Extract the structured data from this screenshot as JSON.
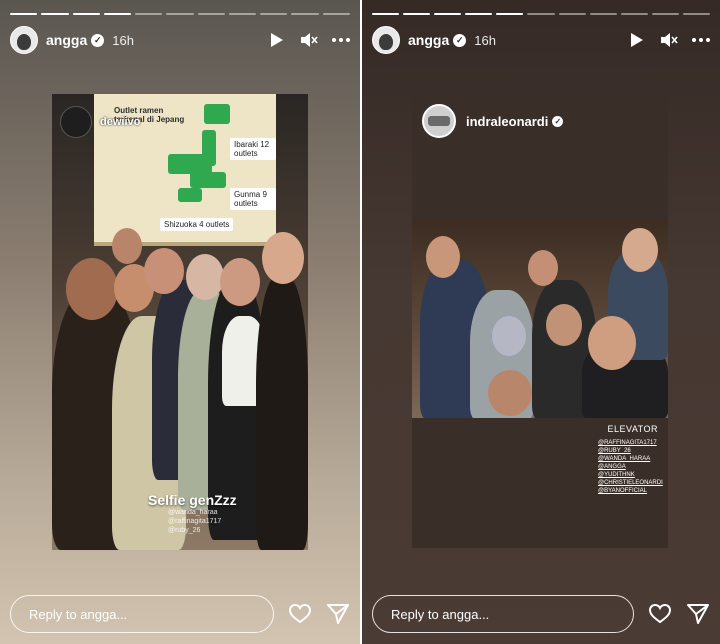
{
  "stories": [
    {
      "username": "angga",
      "time": "16h",
      "reply_placeholder": "Reply to angga...",
      "poster": {
        "username": "dewiivo"
      },
      "board": {
        "title": "Outlet ramen terkenal di Jepang",
        "tags": [
          "Ibaraki 12 outlets",
          "Gunma 9 outlets",
          "Shizuoka 4 outlets"
        ]
      },
      "caption": "Selfie genZzz",
      "mentions": [
        "@wanda_haraa",
        "@raffinagita1717",
        "@ruby_26"
      ],
      "progress_segments": 11,
      "progress_done": 4
    },
    {
      "username": "angga",
      "time": "16h",
      "reply_placeholder": "Reply to angga...",
      "repost": {
        "username": "indraleonardi"
      },
      "caption": "ELEVATOR",
      "mentions": [
        "@RAFFINAGITA1717",
        "@RUBY_26",
        "@WANDA_HARAA",
        "@ANGGA",
        "@YUDITHNK",
        "@CHRISTIELEONARDI",
        "@BYANOFFICIAL"
      ],
      "progress_segments": 11,
      "progress_done": 5
    }
  ],
  "icons": {
    "play": "play-icon",
    "mute": "mute-icon",
    "more": "more-icon",
    "like": "heart-icon",
    "share": "send-icon"
  }
}
